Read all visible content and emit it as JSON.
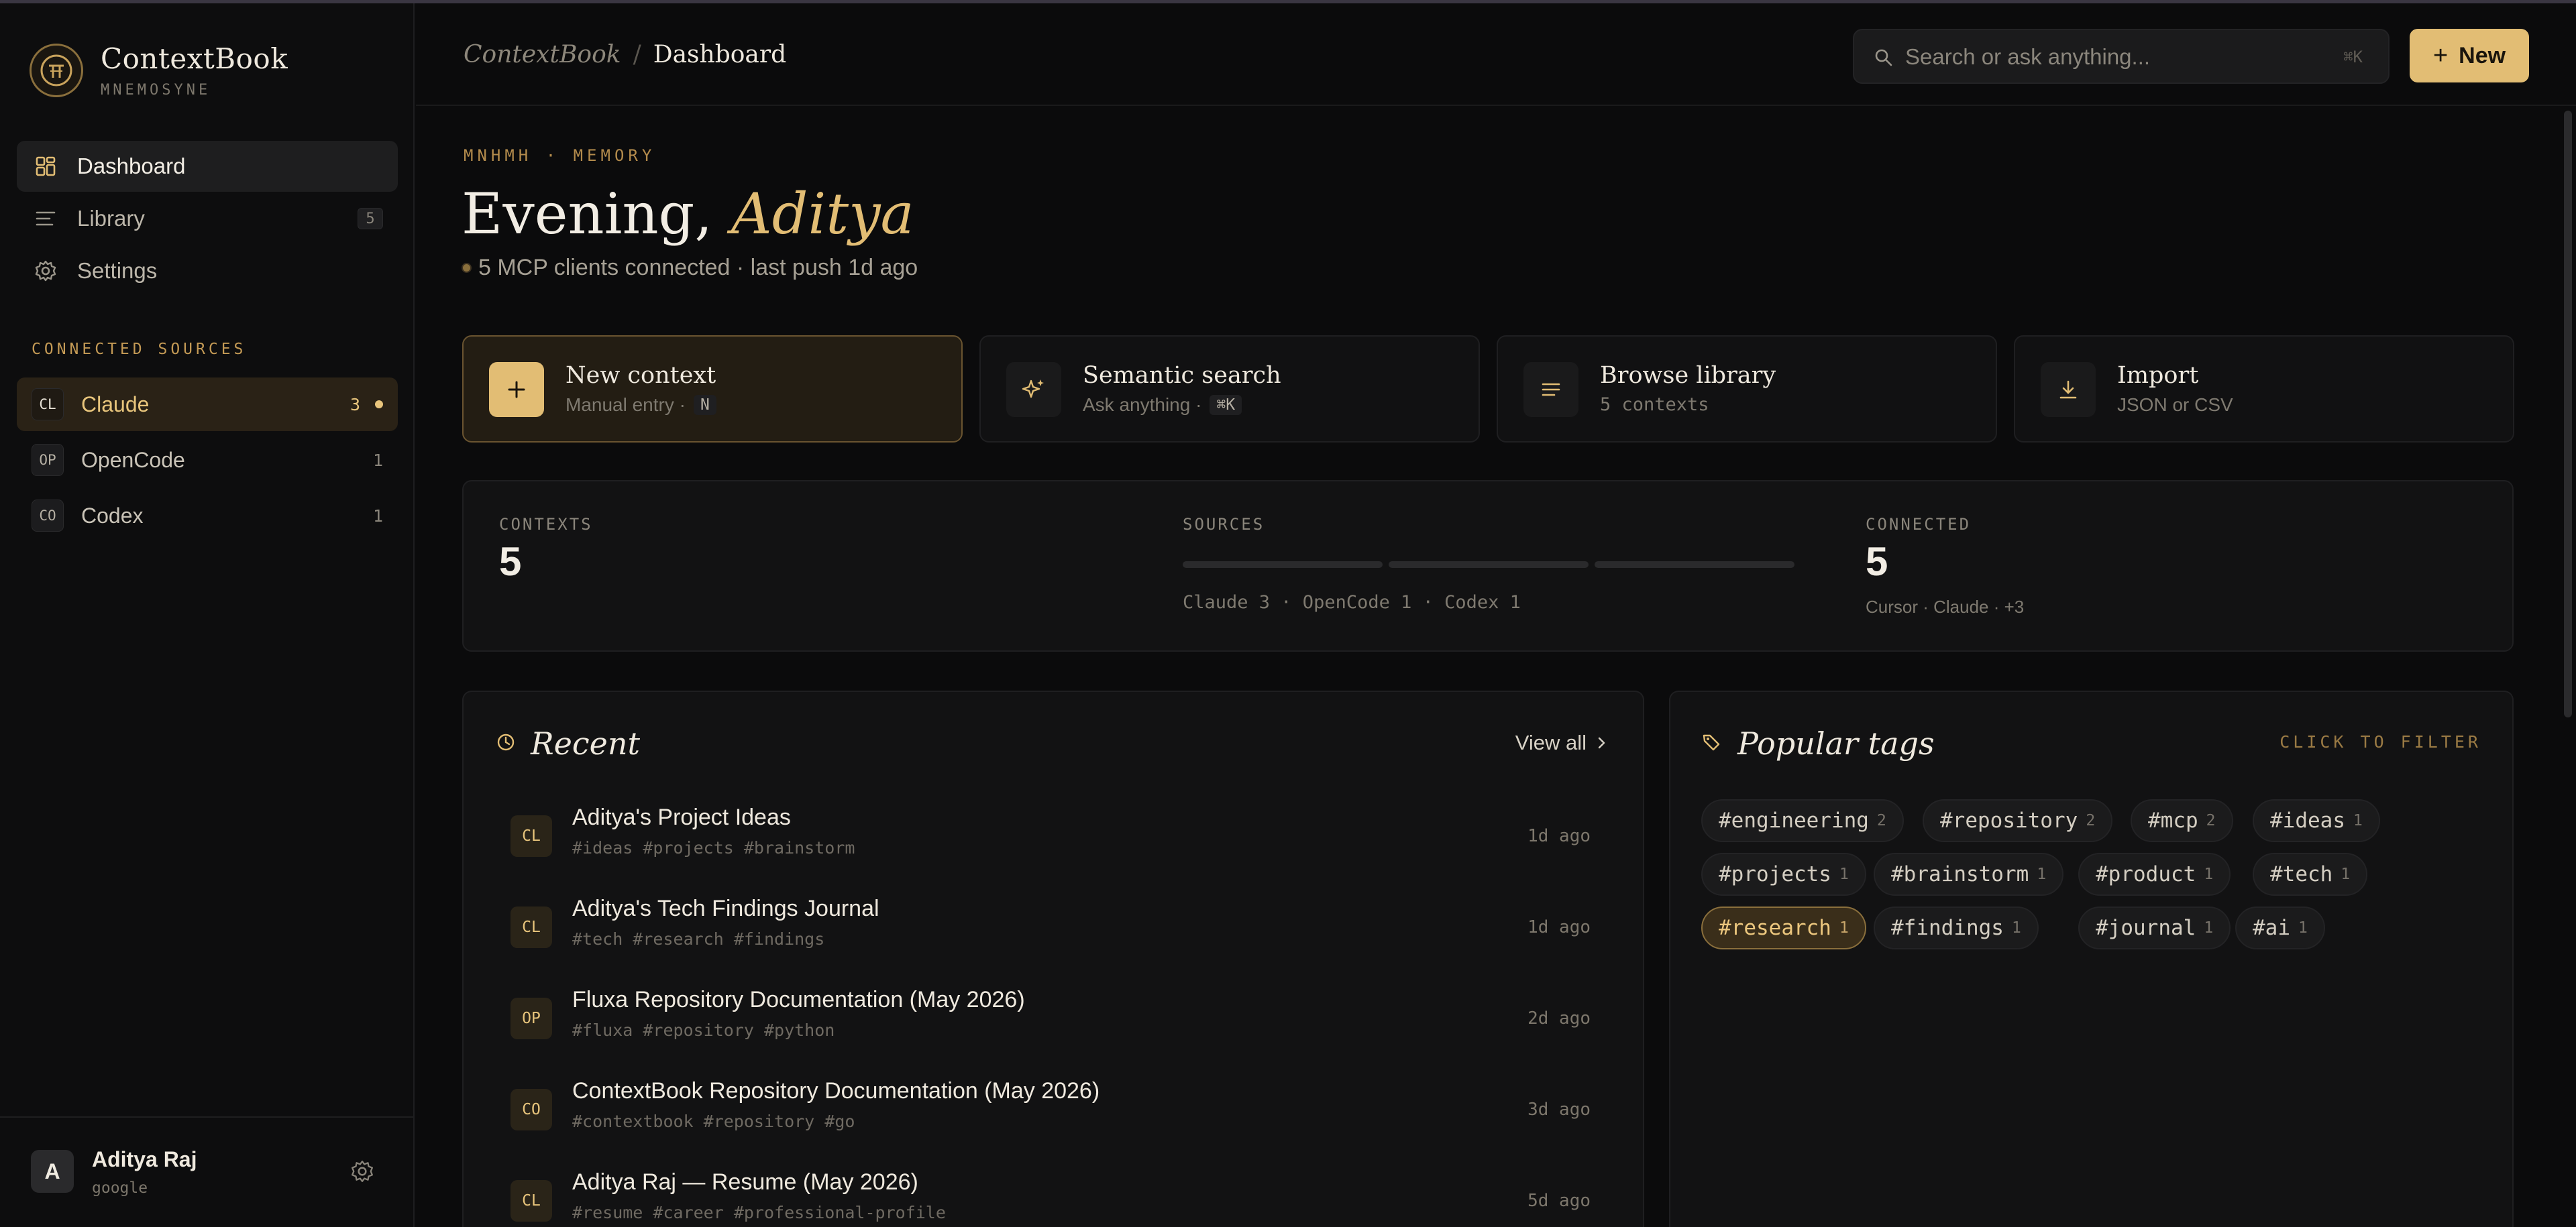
{
  "brand": {
    "name": "ContextBook",
    "subtitle": "MNEMOSYNE"
  },
  "nav": [
    {
      "label": "Dashboard",
      "active": true
    },
    {
      "label": "Library",
      "count": "5"
    },
    {
      "label": "Settings"
    }
  ],
  "sources": {
    "title": "CONNECTED SOURCES",
    "items": [
      {
        "badge": "CL",
        "name": "Claude",
        "count": "3",
        "active": true
      },
      {
        "badge": "OP",
        "name": "OpenCode",
        "count": "1"
      },
      {
        "badge": "CO",
        "name": "Codex",
        "count": "1"
      }
    ]
  },
  "user": {
    "initial": "A",
    "name": "Aditya Raj",
    "provider": "google"
  },
  "header": {
    "breadcrumb_root": "ContextBook",
    "breadcrumb_sep": "/",
    "breadcrumb_current": "Dashboard",
    "search_placeholder": "Search or ask anything...",
    "search_shortcut": "⌘K",
    "new_label": "New"
  },
  "hero": {
    "eyebrow": "MNHMH · MEMORY",
    "greeting": "Evening,",
    "name": "Aditya",
    "status": "5 MCP clients connected · last push 1d  ago"
  },
  "actions": [
    {
      "title": "New context",
      "sub": "Manual entry ·",
      "key": "N"
    },
    {
      "title": "Semantic search",
      "sub": "Ask anything ·",
      "key": "⌘K"
    },
    {
      "title": "Browse library",
      "sub": "5 contexts"
    },
    {
      "title": "Import",
      "sub": "JSON or CSV"
    }
  ],
  "stats": {
    "contexts": {
      "label": "CONTEXTS",
      "value": "5"
    },
    "sources": {
      "label": "SOURCES",
      "breakdown": "Claude 3 · OpenCode 1 · Codex 1"
    },
    "connected": {
      "label": "CONNECTED",
      "value": "5",
      "sub": "Cursor · Claude · +3"
    }
  },
  "recent": {
    "title": "Recent",
    "view_all": "View all",
    "items": [
      {
        "badge": "CL",
        "title": "Aditya's Project Ideas",
        "tags": "#ideas #projects #brainstorm",
        "time": "1d ago"
      },
      {
        "badge": "CL",
        "title": "Aditya's Tech Findings Journal",
        "tags": "#tech #research #findings",
        "time": "1d ago"
      },
      {
        "badge": "OP",
        "title": "Fluxa Repository Documentation (May 2026)",
        "tags": "#fluxa #repository #python",
        "time": "2d ago"
      },
      {
        "badge": "CO",
        "title": "ContextBook Repository Documentation (May 2026)",
        "tags": "#contextbook #repository #go",
        "time": "3d ago"
      },
      {
        "badge": "CL",
        "title": "Aditya Raj — Resume (May 2026)",
        "tags": "#resume #career #professional-profile",
        "time": "5d ago"
      }
    ]
  },
  "tags": {
    "title": "Popular tags",
    "hint": "CLICK TO FILTER",
    "items": [
      {
        "name": "#engineering",
        "count": "2"
      },
      {
        "name": "#repository",
        "count": "2"
      },
      {
        "name": "#mcp",
        "count": "2"
      },
      {
        "name": "#ideas",
        "count": "1"
      },
      {
        "name": "#projects",
        "count": "1"
      },
      {
        "name": "#brainstorm",
        "count": "1"
      },
      {
        "name": "#product",
        "count": "1"
      },
      {
        "name": "#tech",
        "count": "1"
      },
      {
        "name": "#research",
        "count": "1",
        "active": true
      },
      {
        "name": "#findings",
        "count": "1"
      },
      {
        "name": "#journal",
        "count": "1"
      },
      {
        "name": "#ai",
        "count": "1"
      }
    ]
  },
  "colors": {
    "accent": "#e2bd74",
    "background": "#0b0b0c",
    "panel": "#121213"
  }
}
